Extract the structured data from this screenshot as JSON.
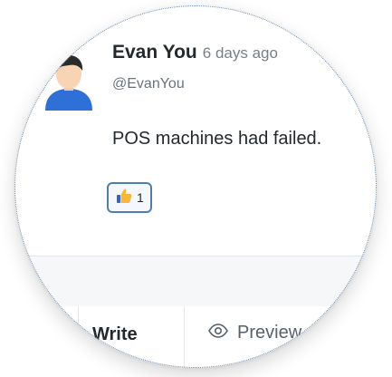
{
  "comment": {
    "author_name": "Evan You",
    "timestamp": "6 days ago",
    "handle": "@EvanYou",
    "body": "POS machines had failed.",
    "reaction": {
      "icon": "thumbs-up-icon",
      "count": "1"
    }
  },
  "editor": {
    "tabs": {
      "write": "Write",
      "preview": "Preview"
    }
  },
  "colors": {
    "accent": "#4f7eac",
    "text": "#24292e",
    "muted": "#6a737d"
  }
}
